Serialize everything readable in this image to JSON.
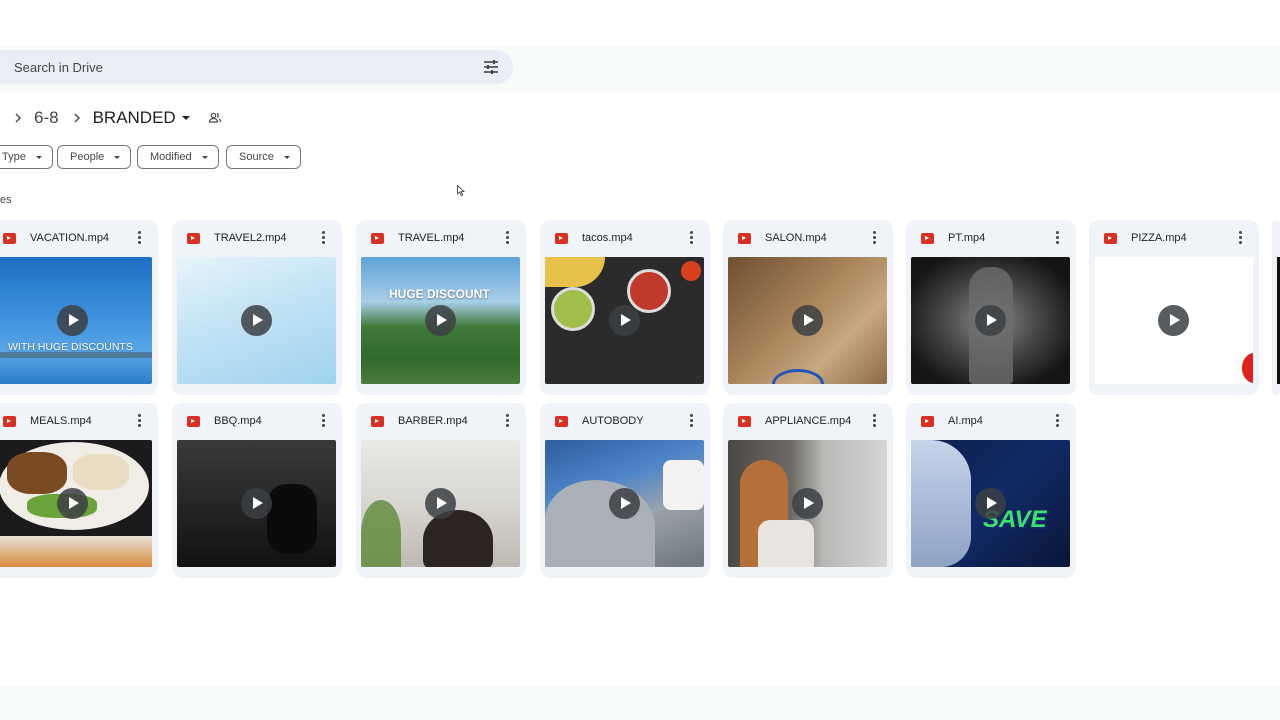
{
  "search": {
    "placeholder": "Search in Drive"
  },
  "breadcrumb": {
    "parent": "6-8",
    "current": "BRANDED"
  },
  "filters": [
    "Type",
    "People",
    "Modified",
    "Source"
  ],
  "section": {
    "label": "es"
  },
  "files": [
    {
      "name": "VACATION.mp4",
      "overlay": "WITH HUGE DISCOUNTS"
    },
    {
      "name": "TRAVEL2.mp4",
      "overlay": ""
    },
    {
      "name": "TRAVEL.mp4",
      "overlay": "HUGE DISCOUNT"
    },
    {
      "name": "tacos.mp4",
      "overlay": ""
    },
    {
      "name": "SALON.mp4",
      "overlay": ""
    },
    {
      "name": "PT.mp4",
      "overlay": ""
    },
    {
      "name": "PIZZA.mp4",
      "overlay": ""
    },
    {
      "name": "MEALS.mp4",
      "overlay": ""
    },
    {
      "name": "BBQ.mp4",
      "overlay": ""
    },
    {
      "name": "BARBER.mp4",
      "overlay": ""
    },
    {
      "name": "AUTOBODY",
      "overlay": ""
    },
    {
      "name": "APPLIANCE.mp4",
      "overlay": ""
    },
    {
      "name": "AI.mp4",
      "overlay": "SAVE"
    }
  ],
  "colors": {
    "accent": "#d93025",
    "chipBorder": "#747775",
    "cardBg": "#f0f4f9",
    "searchBg": "#e9eef6"
  }
}
